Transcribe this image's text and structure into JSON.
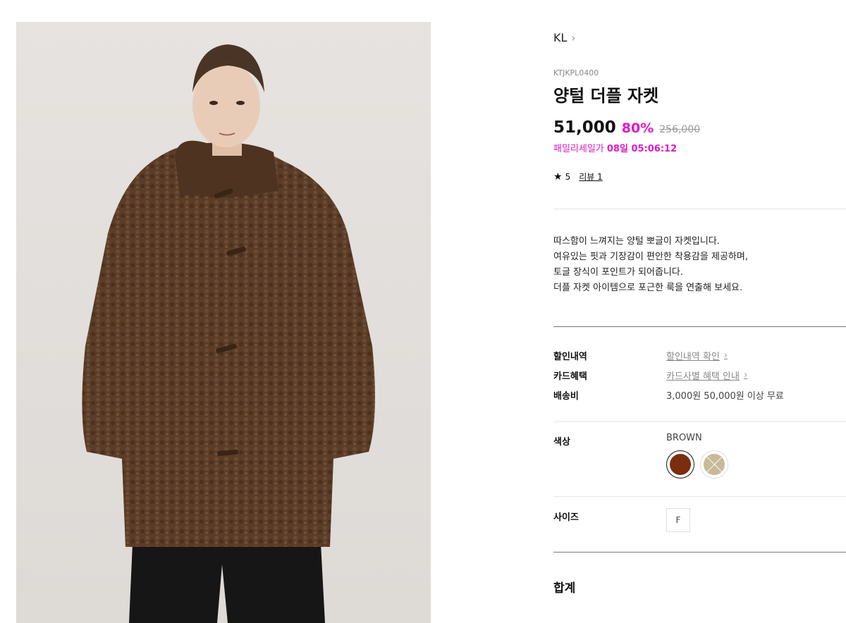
{
  "product": {
    "brand": "KL",
    "code": "KTJKPL0400",
    "title": "양털 더플 자켓",
    "price": "51,000",
    "discount": "80%",
    "original_price": "256,000",
    "timer_label": "패밀리세일가",
    "timer_value": "08일 05:06:12",
    "rating": "5",
    "review_label": "리뷰 1",
    "description": [
      "따스함이 느껴지는 양털 뽀글이 자켓입니다.",
      "여유있는 핏과 기장감이 편안한 착용감을 제공하며,",
      "토글 장식이 포인트가 되어줍니다.",
      "더플 자켓 아이템으로 포근한 룩을 연출해 보세요."
    ]
  },
  "benefits": {
    "discount_label": "할인내역",
    "discount_value": "할인내역 확인",
    "card_label": "카드혜택",
    "card_value": "카드사별 혜택 안내",
    "shipping_label": "배송비",
    "shipping_value": "3,000원 50,000원 이상 무료"
  },
  "options": {
    "color_label": "색상",
    "selected_color": "BROWN",
    "swatches": [
      {
        "name": "BROWN",
        "color": "#7a2e0e",
        "selected": true,
        "sold_out": false
      },
      {
        "name": "BEIGE",
        "color": "#c9b997",
        "selected": false,
        "sold_out": true
      }
    ],
    "size_label": "사이즈",
    "sizes": [
      "F"
    ]
  },
  "total_label": "합계",
  "colors": {
    "accent": "#e01ac8",
    "coat": "#5a3b26"
  }
}
